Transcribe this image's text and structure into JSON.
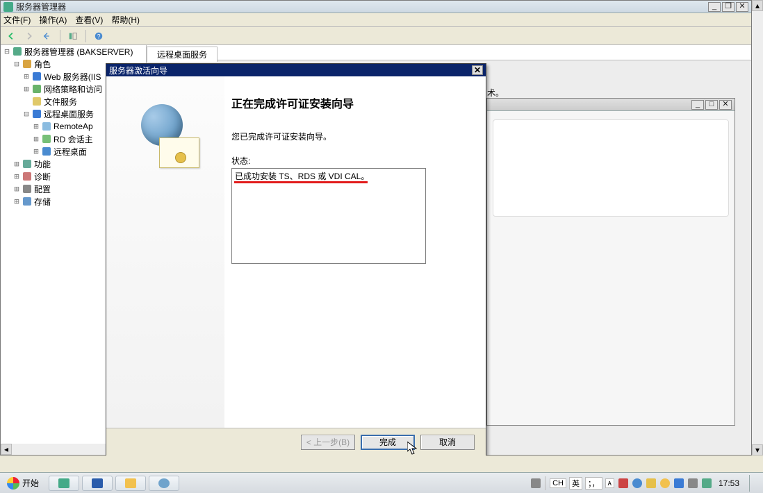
{
  "main_window": {
    "title": "服务器管理器",
    "menus": {
      "file": "文件(F)",
      "action": "操作(A)",
      "view": "查看(V)",
      "help": "帮助(H)"
    }
  },
  "tree": {
    "root": "服务器管理器 (BAKSERVER)",
    "roles": {
      "label": "角色",
      "items": {
        "iis": "Web 服务器(IIS",
        "nap": "网络策略和访问",
        "files": "文件服务",
        "rds": {
          "label": "远程桌面服务",
          "children": {
            "remoteapp": "RemoteAp",
            "rdhost": "RD 会话主",
            "rdconn": "远程桌面"
          }
        }
      }
    },
    "features": "功能",
    "diag": "诊断",
    "config": "配置",
    "storage": "存储"
  },
  "content_tab": "远程桌面服务",
  "context_suffix": "术。",
  "wizard": {
    "title": "服务器激活向导",
    "heading": "正在完成许可证安装向导",
    "message": "您已完成许可证安装向导。",
    "status_label": "状态:",
    "status_text": "已成功安装 TS、RDS 或 VDI CAL。",
    "buttons": {
      "back": "< 上一步(B)",
      "finish": "完成",
      "cancel": "取消"
    }
  },
  "taskbar": {
    "start": "开始",
    "ime": {
      "ch": "CH",
      "lang": "英",
      "punct": "；，",
      "full": "ᴀ"
    },
    "clock": "17:53"
  }
}
